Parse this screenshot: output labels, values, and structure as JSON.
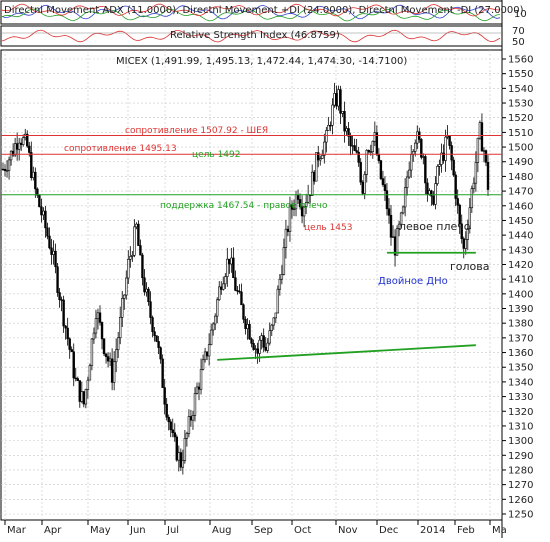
{
  "panels": {
    "dmi": {
      "label": "Directnl Movement ADX (11.0000), Directnl Movement +DI (24.0000), Directnl Movement -DI (27.0000)",
      "ticks": [
        "10"
      ]
    },
    "rsi": {
      "label": "Relative Strength Index (46.8759)",
      "ticks": [
        "70",
        "50"
      ]
    }
  },
  "chart_data": {
    "type": "candlestick",
    "title": "MICEX (1,491.99, 1,495.13, 1,472.44, 1,474.30, -14.7100)",
    "ylim": [
      1250,
      1565
    ],
    "y_ticks": [
      1250,
      1260,
      1270,
      1280,
      1290,
      1300,
      1310,
      1320,
      1330,
      1340,
      1350,
      1360,
      1370,
      1380,
      1390,
      1400,
      1410,
      1420,
      1430,
      1440,
      1450,
      1460,
      1470,
      1480,
      1490,
      1500,
      1510,
      1520,
      1530,
      1540,
      1550,
      1560
    ],
    "x_ticks": [
      "Mar",
      "Apr",
      "May",
      "Jun",
      "Jul",
      "Aug",
      "Sep",
      "Oct",
      "Nov",
      "Dec",
      "2014",
      "Feb",
      "Ma"
    ],
    "grid": true,
    "close_path": [
      [
        0,
        1485
      ],
      [
        2,
        1495
      ],
      [
        4,
        1508
      ],
      [
        6,
        1500
      ],
      [
        8,
        1470
      ],
      [
        10,
        1450
      ],
      [
        12,
        1430
      ],
      [
        14,
        1400
      ],
      [
        16,
        1370
      ],
      [
        18,
        1340
      ],
      [
        20,
        1325
      ],
      [
        21,
        1345
      ],
      [
        23,
        1390
      ],
      [
        25,
        1365
      ],
      [
        27,
        1345
      ],
      [
        29,
        1380
      ],
      [
        31,
        1420
      ],
      [
        33,
        1445
      ],
      [
        34,
        1420
      ],
      [
        36,
        1390
      ],
      [
        38,
        1370
      ],
      [
        40,
        1330
      ],
      [
        42,
        1300
      ],
      [
        44,
        1285
      ],
      [
        46,
        1310
      ],
      [
        48,
        1335
      ],
      [
        50,
        1355
      ],
      [
        52,
        1380
      ],
      [
        54,
        1410
      ],
      [
        56,
        1425
      ],
      [
        57,
        1410
      ],
      [
        59,
        1390
      ],
      [
        61,
        1375
      ],
      [
        63,
        1360
      ],
      [
        64,
        1372
      ],
      [
        65,
        1362
      ],
      [
        67,
        1380
      ],
      [
        69,
        1420
      ],
      [
        71,
        1455
      ],
      [
        73,
        1470
      ],
      [
        74,
        1460
      ],
      [
        76,
        1472
      ],
      [
        78,
        1495
      ],
      [
        80,
        1505
      ],
      [
        81,
        1520
      ],
      [
        82,
        1530
      ],
      [
        83,
        1535
      ],
      [
        84,
        1518
      ],
      [
        86,
        1500
      ],
      [
        88,
        1490
      ],
      [
        89,
        1472
      ],
      [
        90,
        1500
      ],
      [
        92,
        1505
      ],
      [
        93,
        1485
      ],
      [
        95,
        1460
      ],
      [
        96,
        1440
      ],
      [
        97,
        1432
      ],
      [
        99,
        1455
      ],
      [
        100,
        1480
      ],
      [
        101,
        1500
      ],
      [
        102,
        1508
      ],
      [
        104,
        1495
      ],
      [
        105,
        1470
      ],
      [
        106,
        1460
      ],
      [
        108,
        1488
      ],
      [
        110,
        1505
      ],
      [
        111,
        1490
      ],
      [
        112,
        1470
      ],
      [
        113,
        1445
      ],
      [
        114,
        1430
      ],
      [
        116,
        1470
      ],
      [
        117,
        1490
      ],
      [
        118,
        1510
      ],
      [
        119,
        1498
      ],
      [
        120,
        1474
      ]
    ],
    "horizontal_lines": [
      {
        "value": 1507.92,
        "color": "#dd3333"
      },
      {
        "value": 1495.13,
        "color": "#dd3333"
      },
      {
        "value": 1467.54,
        "color": "#22a022"
      }
    ],
    "trend_lines": [
      {
        "from": [
          53,
          1355
        ],
        "to": [
          117,
          1365
        ],
        "color": "#22a022"
      },
      {
        "from": [
          95,
          1428
        ],
        "to": [
          117,
          1428
        ],
        "color": "#22a022"
      }
    ],
    "annotations": [
      {
        "text": "сопротивление 1507.92 - ШЕЯ",
        "color": "#dd3333"
      },
      {
        "text": "сопротивление 1495.13",
        "color": "#dd3333"
      },
      {
        "text": "цель 1492",
        "color": "#22a022"
      },
      {
        "text": "поддержка 1467.54 - правое плечо",
        "color": "#22a022"
      },
      {
        "text": "цель 1453",
        "color": "#dd3333"
      },
      {
        "text": "левое плечо",
        "color": "#222222"
      },
      {
        "text": "голова",
        "color": "#222222"
      },
      {
        "text": "Двойное ДНо",
        "color": "#2233cc"
      }
    ]
  }
}
